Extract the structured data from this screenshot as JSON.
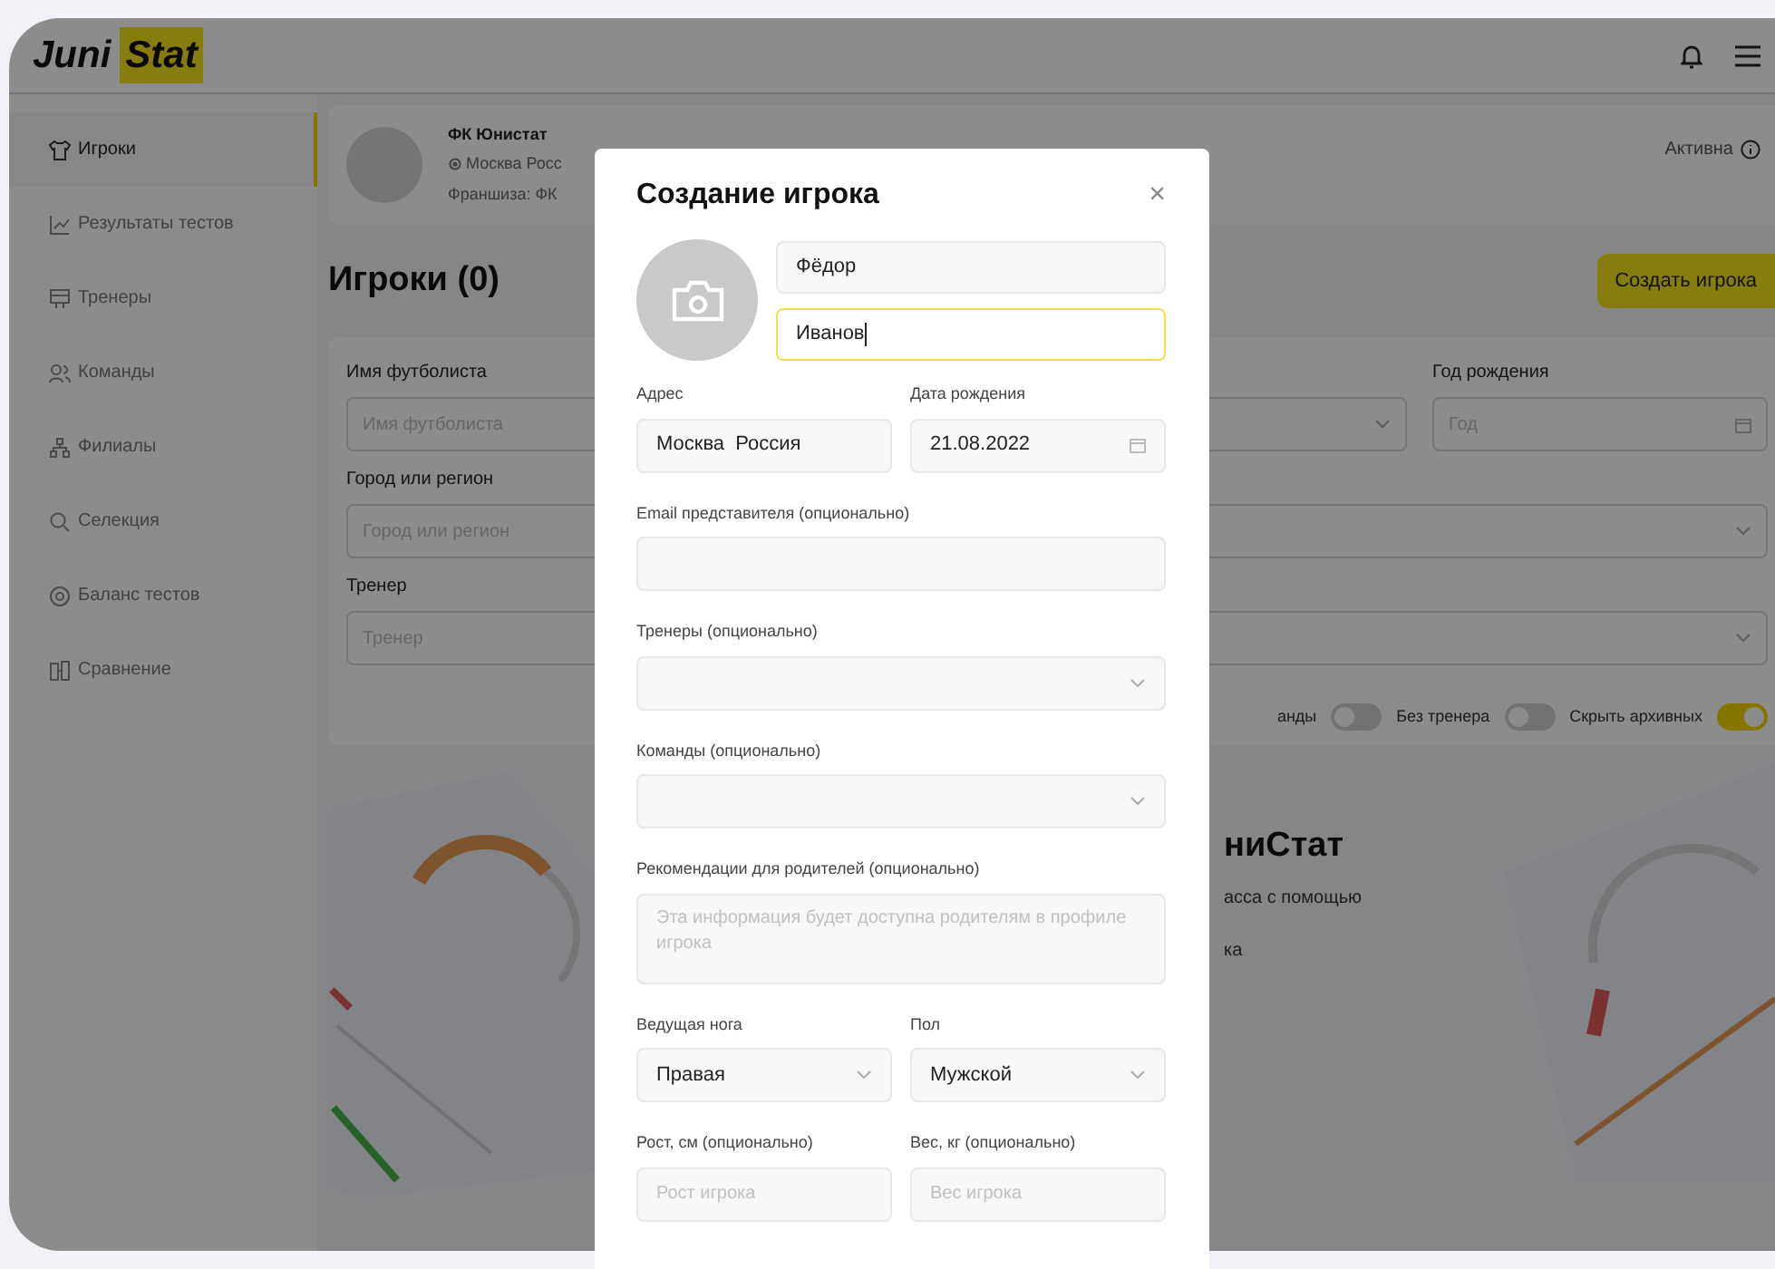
{
  "logo": {
    "first": "Juni",
    "second": "Stat"
  },
  "sidebar": {
    "items": [
      {
        "label": "Игроки",
        "selected": true
      },
      {
        "label": "Результаты тестов",
        "selected": false
      },
      {
        "label": "Тренеры",
        "selected": false
      },
      {
        "label": "Команды",
        "selected": false
      },
      {
        "label": "Филиалы",
        "selected": false
      },
      {
        "label": "Селекция",
        "selected": false
      },
      {
        "label": "Баланс тестов",
        "selected": false
      },
      {
        "label": "Сравнение",
        "selected": false
      }
    ]
  },
  "club": {
    "name": "ФК Юнистат",
    "location": "Москва Росс",
    "franchise": "Франшиза: ФК",
    "status": "Активна"
  },
  "page_title": "Игроки (0)",
  "create_button": "Создать игрока",
  "filters": {
    "fields": [
      {
        "label": "Имя футболиста",
        "placeholder": "Имя футболиста"
      },
      {
        "label": "Город или регион",
        "placeholder": "Город или регион"
      },
      {
        "label": "Тренер",
        "placeholder": "Тренер"
      }
    ],
    "birth_year": {
      "label": "Год рождения",
      "placeholder": "Год"
    },
    "toggles": [
      {
        "label": "анды",
        "on": false
      },
      {
        "label": "Без тренера",
        "on": false
      },
      {
        "label": "Скрыть архивных",
        "on": true
      }
    ]
  },
  "promo": {
    "title": "ниСтат",
    "lines": [
      "асса с помощью",
      "ка"
    ]
  },
  "modal": {
    "title": "Создание игрока",
    "close": "×",
    "first_name": {
      "value": "Фёдор",
      "focused": false
    },
    "last_name": {
      "value": "Иванов",
      "focused": true
    },
    "rows": [
      [
        {
          "kind": "input",
          "label": "Адрес",
          "value": "Москва  Россия"
        },
        {
          "kind": "date",
          "label": "Дата рождения",
          "value": "21.08.2022"
        }
      ],
      [
        {
          "kind": "input",
          "label": "Email представителя (опционально)"
        }
      ],
      [
        {
          "kind": "select",
          "label": "Тренеры (опционально)"
        }
      ],
      [
        {
          "kind": "select",
          "label": "Команды (опционально)"
        }
      ],
      [
        {
          "kind": "textarea",
          "label": "Рекомендации для родителей (опционально)",
          "placeholder": "Эта информация будет доступна родителям в профиле игрока"
        }
      ],
      [
        {
          "kind": "select",
          "label": "Ведущая нога",
          "value": "Правая"
        },
        {
          "kind": "select",
          "label": "Пол",
          "value": "Мужской"
        }
      ],
      [
        {
          "kind": "input",
          "label": "Рост, см (опционально)",
          "placeholder": "Рост игрока"
        },
        {
          "kind": "input",
          "label": "Вес, кг (опционально)",
          "placeholder": "Вес игрока"
        }
      ]
    ]
  }
}
